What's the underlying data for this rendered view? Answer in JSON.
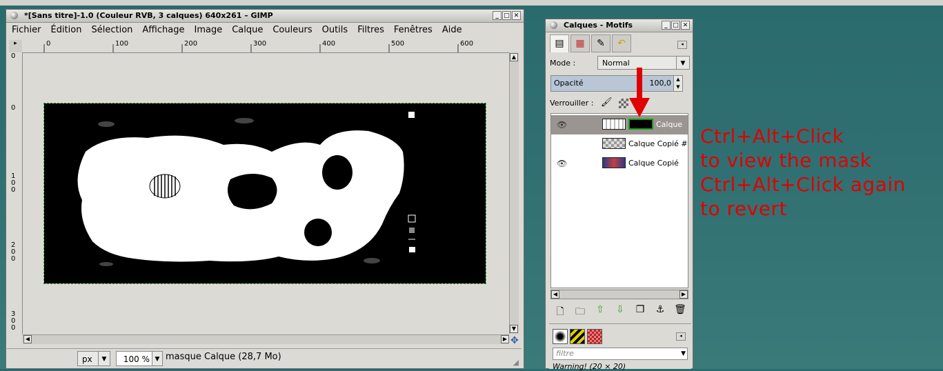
{
  "image_window": {
    "title": "*[Sans titre]-1.0 (Couleur RVB, 3 calques) 640x261 – GIMP",
    "menu": [
      "Fichier",
      "Édition",
      "Sélection",
      "Affichage",
      "Image",
      "Calque",
      "Couleurs",
      "Outils",
      "Filtres",
      "Fenêtres",
      "Aide"
    ],
    "ruler_h_labels": [
      "0",
      "100",
      "200",
      "300",
      "400",
      "500",
      "600"
    ],
    "ruler_v_labels": [
      "0",
      "0",
      "1 0 0",
      "2 0 0",
      "3 0 0"
    ],
    "status": {
      "unit": "px",
      "zoom": "100 %",
      "message": "masque Calque (28,7 Mo)"
    }
  },
  "layers_dock": {
    "title": "Calques - Motifs",
    "mode_label": "Mode :",
    "mode_value": "Normal",
    "opacity_label": "Opacité",
    "opacity_value": "100,0",
    "lock_label": "Verrouiller :",
    "layers": [
      {
        "name": "Calque",
        "visible": true,
        "selected": true
      },
      {
        "name": "Calque Copié #",
        "visible": false,
        "selected": false
      },
      {
        "name": "Calque Copié",
        "visible": true,
        "selected": false
      }
    ],
    "filter_placeholder": "filtre",
    "warning_text": "Warning! (20 × 20)"
  },
  "annotation": {
    "lines": [
      "Ctrl+Alt+Click",
      "to view the mask",
      "Ctrl+Alt+Click again",
      "to revert"
    ],
    "color": "#e00000"
  },
  "colors": {
    "background": "#2f6f71",
    "window_bg": "#dcdad5",
    "selected_layer_bg": "#9a9590",
    "mask_border": "#1a9a1a"
  }
}
